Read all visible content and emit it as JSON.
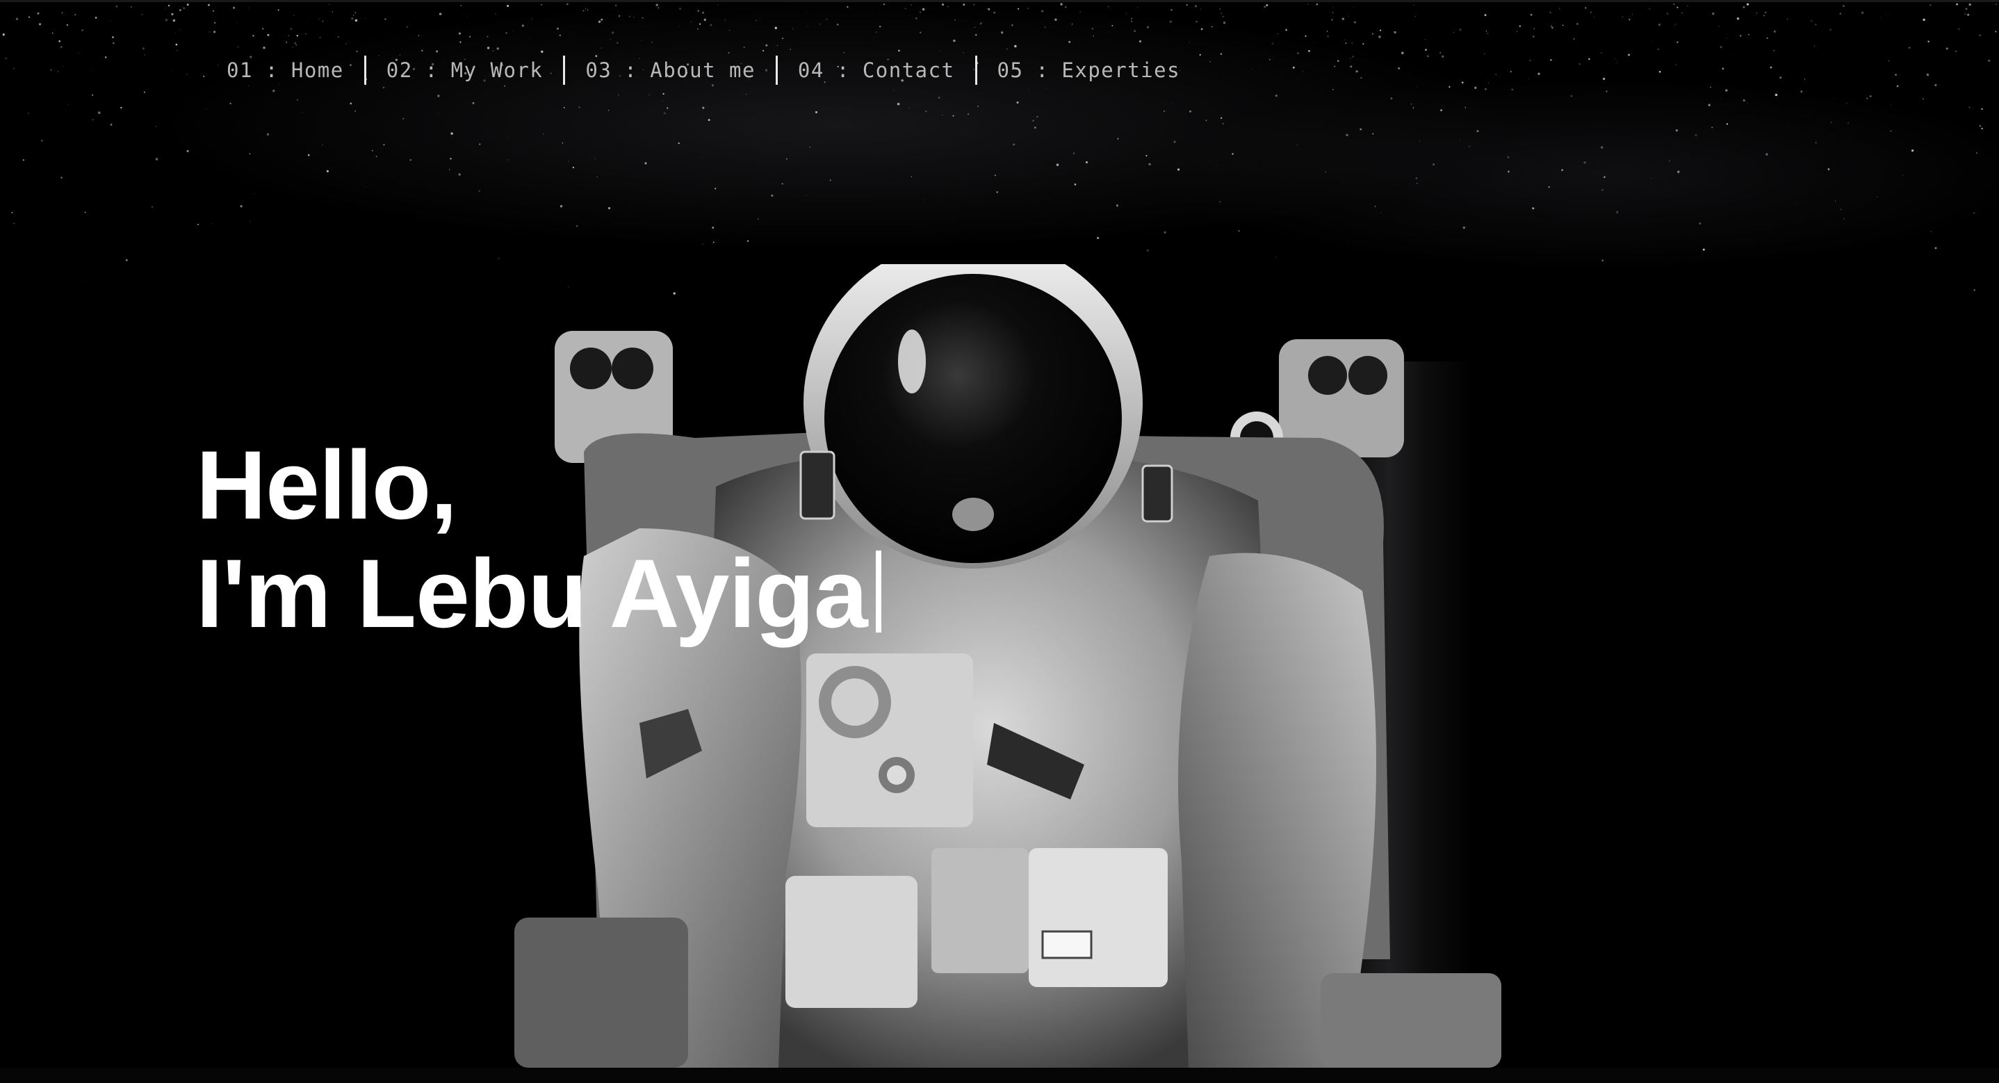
{
  "nav": {
    "items": [
      {
        "number": "01",
        "separator": ":",
        "label": "Home"
      },
      {
        "number": "02",
        "separator": ":",
        "label": "My Work"
      },
      {
        "number": "03",
        "separator": ":",
        "label": "About me"
      },
      {
        "number": "04",
        "separator": ":",
        "label": "Contact"
      },
      {
        "number": "05",
        "separator": ":",
        "label": "Experties"
      }
    ]
  },
  "hero": {
    "line1": "Hello,",
    "line2": "I'm Lebu Ayiga",
    "image_subject": "astronaut-in-spacesuit",
    "background_icon": "starfield"
  },
  "colors": {
    "background": "#000000",
    "heading": "#ffffff",
    "nav_text": "#b8b8b8",
    "nav_divider": "#e8e8e8"
  }
}
